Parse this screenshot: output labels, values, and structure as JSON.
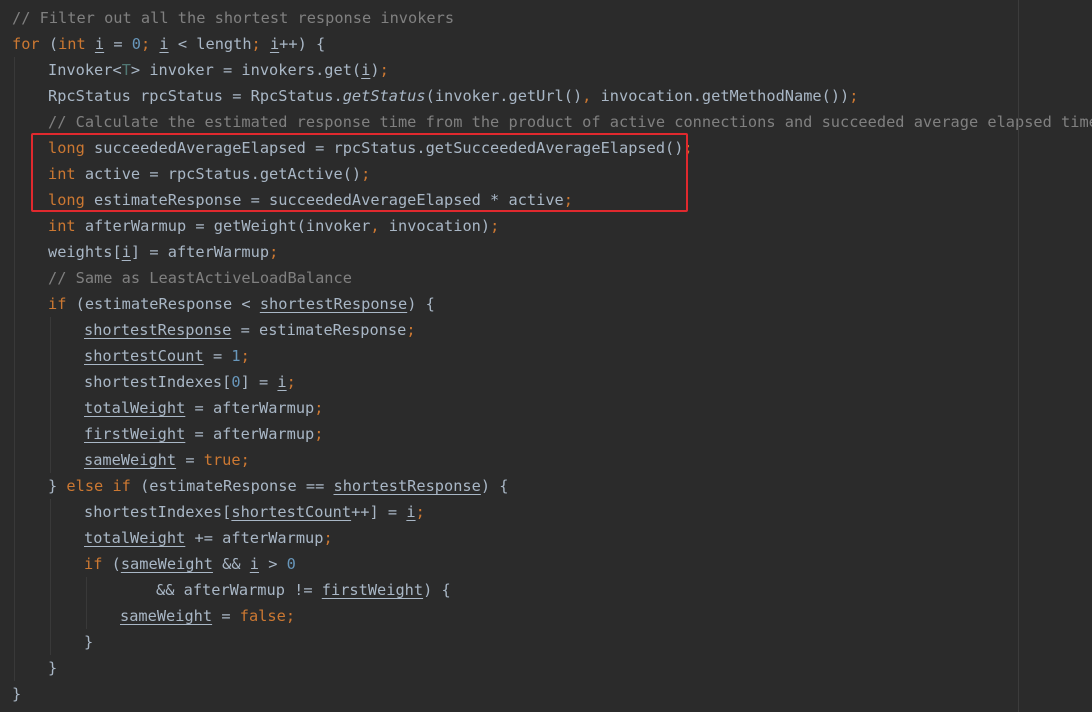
{
  "editor": {
    "language": "java",
    "theme_background": "#2b2b2b",
    "highlight_color": "#e0292e",
    "highlighted_lines": [
      6,
      7,
      8
    ],
    "lines": [
      {
        "indent": 0,
        "tokens": [
          {
            "t": "// Filter out all the shortest response invokers",
            "c": "cmt"
          }
        ]
      },
      {
        "indent": 0,
        "tokens": [
          {
            "t": "for",
            "c": "kw"
          },
          {
            "t": " (",
            "c": "p"
          },
          {
            "t": "int",
            "c": "kw"
          },
          {
            "t": " ",
            "c": "p"
          },
          {
            "t": "i",
            "c": "p ul"
          },
          {
            "t": " = ",
            "c": "p"
          },
          {
            "t": "0",
            "c": "num"
          },
          {
            "t": "; ",
            "c": "kw"
          },
          {
            "t": "i",
            "c": "p ul"
          },
          {
            "t": " < length",
            "c": "p"
          },
          {
            "t": "; ",
            "c": "kw"
          },
          {
            "t": "i",
            "c": "p ul"
          },
          {
            "t": "++) {",
            "c": "p"
          }
        ]
      },
      {
        "indent": 1,
        "tokens": [
          {
            "t": "Invoker<",
            "c": "p"
          },
          {
            "t": "T",
            "c": "tp"
          },
          {
            "t": "> invoker = invokers.get(",
            "c": "p"
          },
          {
            "t": "i",
            "c": "p ul"
          },
          {
            "t": ")",
            "c": "p"
          },
          {
            "t": ";",
            "c": "kw"
          }
        ]
      },
      {
        "indent": 1,
        "tokens": [
          {
            "t": "RpcStatus rpcStatus = RpcStatus.",
            "c": "p"
          },
          {
            "t": "getStatus",
            "c": "p it"
          },
          {
            "t": "(invoker.getUrl()",
            "c": "p"
          },
          {
            "t": ", ",
            "c": "kw"
          },
          {
            "t": "invocation.getMethodName())",
            "c": "p"
          },
          {
            "t": ";",
            "c": "kw"
          }
        ]
      },
      {
        "indent": 1,
        "tokens": [
          {
            "t": "// Calculate the estimated response time from the product of active connections and succeeded average elapsed time.",
            "c": "cmt"
          }
        ]
      },
      {
        "indent": 1,
        "tokens": [
          {
            "t": "long",
            "c": "kw"
          },
          {
            "t": " succeededAverageElapsed = rpcStatus.getSucceededAverageElapsed()",
            "c": "p"
          },
          {
            "t": ";",
            "c": "kw"
          }
        ]
      },
      {
        "indent": 1,
        "tokens": [
          {
            "t": "int",
            "c": "kw"
          },
          {
            "t": " active = rpcStatus.getActive()",
            "c": "p"
          },
          {
            "t": ";",
            "c": "kw"
          }
        ]
      },
      {
        "indent": 1,
        "tokens": [
          {
            "t": "long",
            "c": "kw"
          },
          {
            "t": " estimateResponse = succeededAverageElapsed * active",
            "c": "p"
          },
          {
            "t": ";",
            "c": "kw"
          }
        ]
      },
      {
        "indent": 1,
        "tokens": [
          {
            "t": "int",
            "c": "kw"
          },
          {
            "t": " afterWarmup = getWeight(invoker",
            "c": "p"
          },
          {
            "t": ", ",
            "c": "kw"
          },
          {
            "t": "invocation)",
            "c": "p"
          },
          {
            "t": ";",
            "c": "kw"
          }
        ]
      },
      {
        "indent": 1,
        "tokens": [
          {
            "t": "weights[",
            "c": "p"
          },
          {
            "t": "i",
            "c": "p ul"
          },
          {
            "t": "] = afterWarmup",
            "c": "p"
          },
          {
            "t": ";",
            "c": "kw"
          }
        ]
      },
      {
        "indent": 1,
        "tokens": [
          {
            "t": "// Same as LeastActiveLoadBalance",
            "c": "cmt"
          }
        ]
      },
      {
        "indent": 1,
        "tokens": [
          {
            "t": "if",
            "c": "kw"
          },
          {
            "t": " (estimateResponse < ",
            "c": "p"
          },
          {
            "t": "shortestResponse",
            "c": "p ul"
          },
          {
            "t": ") {",
            "c": "p"
          }
        ]
      },
      {
        "indent": 2,
        "tokens": [
          {
            "t": "shortestResponse",
            "c": "p ul"
          },
          {
            "t": " = estimateResponse",
            "c": "p"
          },
          {
            "t": ";",
            "c": "kw"
          }
        ]
      },
      {
        "indent": 2,
        "tokens": [
          {
            "t": "shortestCount",
            "c": "p ul"
          },
          {
            "t": " = ",
            "c": "p"
          },
          {
            "t": "1",
            "c": "num"
          },
          {
            "t": ";",
            "c": "kw"
          }
        ]
      },
      {
        "indent": 2,
        "tokens": [
          {
            "t": "shortestIndexes[",
            "c": "p"
          },
          {
            "t": "0",
            "c": "num"
          },
          {
            "t": "] = ",
            "c": "p"
          },
          {
            "t": "i",
            "c": "p ul"
          },
          {
            "t": ";",
            "c": "kw"
          }
        ]
      },
      {
        "indent": 2,
        "tokens": [
          {
            "t": "totalWeight",
            "c": "p ul"
          },
          {
            "t": " = afterWarmup",
            "c": "p"
          },
          {
            "t": ";",
            "c": "kw"
          }
        ]
      },
      {
        "indent": 2,
        "tokens": [
          {
            "t": "firstWeight",
            "c": "p ul"
          },
          {
            "t": " = afterWarmup",
            "c": "p"
          },
          {
            "t": ";",
            "c": "kw"
          }
        ]
      },
      {
        "indent": 2,
        "tokens": [
          {
            "t": "sameWeight",
            "c": "p ul"
          },
          {
            "t": " = ",
            "c": "p"
          },
          {
            "t": "true",
            "c": "kw"
          },
          {
            "t": ";",
            "c": "kw"
          }
        ]
      },
      {
        "indent": 1,
        "tokens": [
          {
            "t": "} ",
            "c": "p"
          },
          {
            "t": "else if",
            "c": "kw"
          },
          {
            "t": " (estimateResponse == ",
            "c": "p"
          },
          {
            "t": "shortestResponse",
            "c": "p ul"
          },
          {
            "t": ") {",
            "c": "p"
          }
        ]
      },
      {
        "indent": 2,
        "tokens": [
          {
            "t": "shortestIndexes[",
            "c": "p"
          },
          {
            "t": "shortestCount",
            "c": "p ul"
          },
          {
            "t": "++] = ",
            "c": "p"
          },
          {
            "t": "i",
            "c": "p ul"
          },
          {
            "t": ";",
            "c": "kw"
          }
        ]
      },
      {
        "indent": 2,
        "tokens": [
          {
            "t": "totalWeight",
            "c": "p ul"
          },
          {
            "t": " += afterWarmup",
            "c": "p"
          },
          {
            "t": ";",
            "c": "kw"
          }
        ]
      },
      {
        "indent": 2,
        "tokens": [
          {
            "t": "if",
            "c": "kw"
          },
          {
            "t": " (",
            "c": "p"
          },
          {
            "t": "sameWeight",
            "c": "p ul"
          },
          {
            "t": " && ",
            "c": "p"
          },
          {
            "t": "i",
            "c": "p ul"
          },
          {
            "t": " > ",
            "c": "p"
          },
          {
            "t": "0",
            "c": "num"
          }
        ]
      },
      {
        "indent": 4,
        "tokens": [
          {
            "t": "&& afterWarmup != ",
            "c": "p"
          },
          {
            "t": "firstWeight",
            "c": "p ul"
          },
          {
            "t": ") {",
            "c": "p"
          }
        ]
      },
      {
        "indent": 3,
        "tokens": [
          {
            "t": "sameWeight",
            "c": "p ul"
          },
          {
            "t": " = ",
            "c": "p"
          },
          {
            "t": "false",
            "c": "kw"
          },
          {
            "t": ";",
            "c": "kw"
          }
        ]
      },
      {
        "indent": 2,
        "tokens": [
          {
            "t": "}",
            "c": "p"
          }
        ]
      },
      {
        "indent": 1,
        "tokens": [
          {
            "t": "}",
            "c": "p"
          }
        ]
      },
      {
        "indent": 0,
        "tokens": [
          {
            "t": "}",
            "c": "p"
          }
        ]
      }
    ]
  }
}
